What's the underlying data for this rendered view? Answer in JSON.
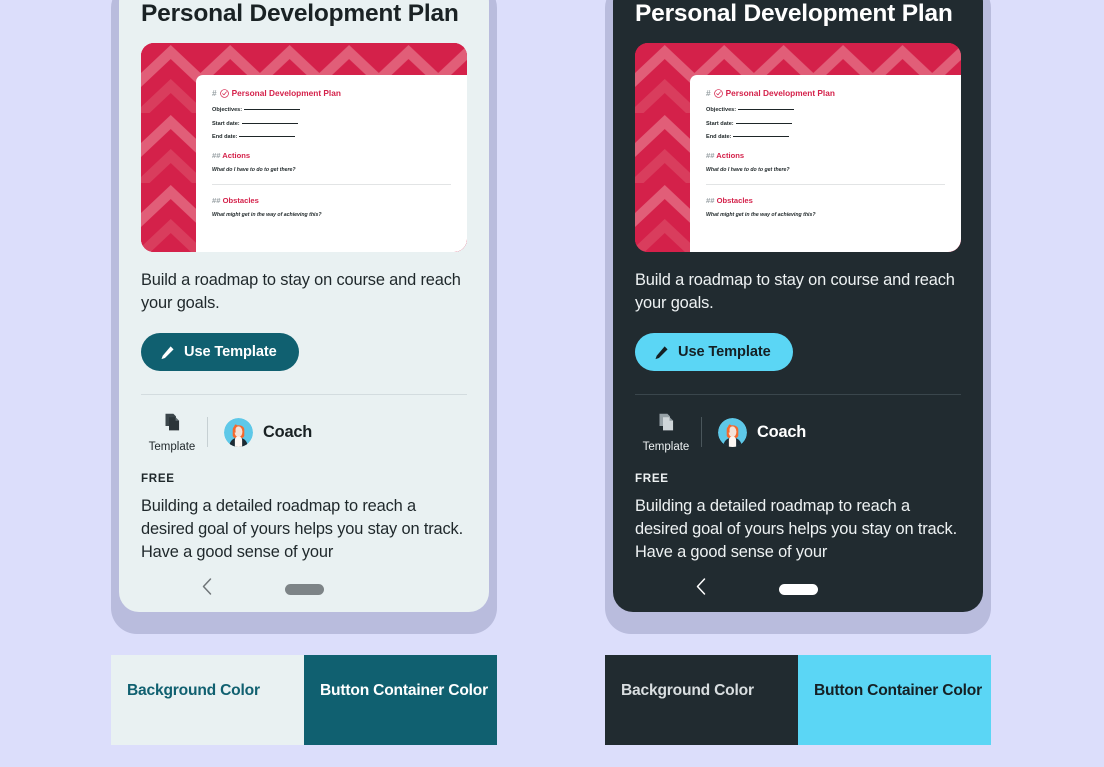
{
  "page": {
    "background_color": "#dcdefb"
  },
  "variants": [
    {
      "id": "light",
      "theme_name": "light",
      "screen_background_color": "#e9f1f2",
      "title": "Personal Development Plan",
      "subtitle": "Build a roadmap to stay on course and reach your goals.",
      "button": {
        "label": "Use Template",
        "icon": "pencil-icon",
        "background_color": "#106070",
        "text_color": "#ffffff"
      },
      "meta": {
        "template_label": "Template",
        "template_icon": "copy-documents-icon",
        "author_name": "Coach",
        "author_avatar": "coach-avatar"
      },
      "price": "FREE",
      "body": "Building a detailed roadmap to reach a desired goal of yours helps you stay on track. Have a good sense of your",
      "navbar": {
        "back_icon": "chevron-left-icon",
        "home_indicator": "home-pill-indicator"
      },
      "swatches": [
        {
          "label": "Background Color",
          "color": "#e9f1f2",
          "text_color": "#106070"
        },
        {
          "label": "Button Container Color",
          "color": "#106070",
          "text_color": "#ffffff"
        }
      ]
    },
    {
      "id": "dark",
      "theme_name": "dark",
      "screen_background_color": "#212b30",
      "title": "Personal Development Plan",
      "subtitle": "Build a roadmap to stay on course and reach your goals.",
      "button": {
        "label": "Use Template",
        "icon": "pencil-icon",
        "background_color": "#5bd6f5",
        "text_color": "#152024"
      },
      "meta": {
        "template_label": "Template",
        "template_icon": "copy-documents-icon",
        "author_name": "Coach",
        "author_avatar": "coach-avatar"
      },
      "price": "FREE",
      "body": "Building a detailed roadmap to reach a desired goal of yours helps you stay on track. Have a good sense of your",
      "navbar": {
        "back_icon": "chevron-left-icon",
        "home_indicator": "home-pill-indicator"
      },
      "swatches": [
        {
          "label": "Background Color",
          "color": "#212b30",
          "text_color": "#d9dee0"
        },
        {
          "label": "Button Container Color",
          "color": "#5bd6f5",
          "text_color": "#152024"
        }
      ]
    }
  ],
  "hero_document": {
    "background_color": "#d4214a",
    "hash_mark": "#",
    "emoji": "check-circle-emoji",
    "heading": "Personal Development Plan",
    "fields": [
      {
        "label": "Objectives:"
      },
      {
        "label": "Start date:"
      },
      {
        "label": "End date:"
      }
    ],
    "sections": [
      {
        "hash": "##",
        "heading": "Actions",
        "note": "What do I have to do to get there?"
      },
      {
        "hash": "##",
        "heading": "Obstacles",
        "note": "What might get in the way of achieving this?"
      }
    ]
  }
}
